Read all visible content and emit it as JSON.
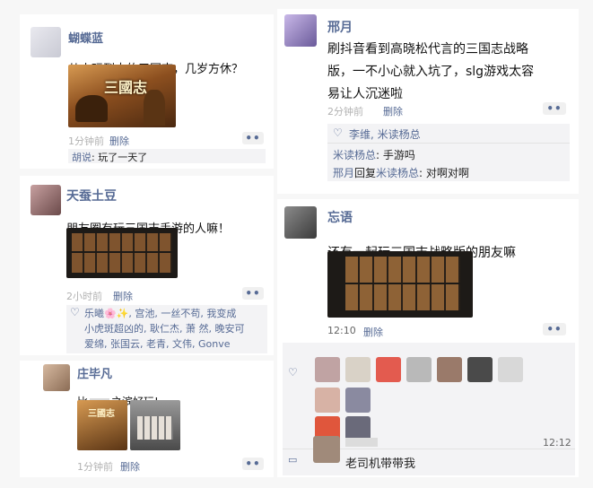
{
  "post1": {
    "name": "蝴蝶蓝",
    "text": "从小玩到大的三国志，几岁方休？",
    "time": "1分钟前",
    "delete": "删除",
    "comment": {
      "author": "胡说",
      "sep": ": ",
      "text": "玩了一天了"
    },
    "thumb_title": "三國志"
  },
  "post2": {
    "name": "天蚕土豆",
    "text": "朋友圈有玩三国志手游的人嘛！",
    "time": "2小时前",
    "delete": "删除",
    "likes": "乐曦🌸✨, 宫池, 一丝不苟, 我变成\n小虎斑超凶的, 耿仁杰, 萧 然, 晚安可\n爱绵, 张国云, 老青, 文伟, Gonve"
  },
  "post3": {
    "name": "庄毕凡",
    "text_a": "比",
    "text_b": "之滨好玩!",
    "time": "1分钟前",
    "delete": "删除",
    "thumb_title": "三國志"
  },
  "post4": {
    "name": "邢月",
    "text": "刷抖音看到高晓松代言的三国志战略\n版，一不小心就入坑了，slg游戏太容\n易让人沉迷啦",
    "time": "2分钟前",
    "delete": "删除",
    "likes": "李维, 米读杨总",
    "comments": [
      {
        "author": "米读杨总",
        "sep": ": ",
        "text": "手游吗"
      },
      {
        "author": "邢月",
        "reply_word": "回复",
        "target": "米读杨总",
        "sep": ": ",
        "text": "对啊对啊"
      }
    ]
  },
  "post5": {
    "name": "忘语",
    "text": "还有一起玩三国志战略版的朋友嘛",
    "time": "12:10",
    "delete": "删除",
    "comment_time": "12:12",
    "comment_text": "老司机带带我"
  },
  "icons": {
    "more": "••",
    "heart": "♡",
    "comment": "▭"
  },
  "colors": {
    "link": "#576b95",
    "meta": "#b2b2b2",
    "bg": "#f7f7f7"
  }
}
